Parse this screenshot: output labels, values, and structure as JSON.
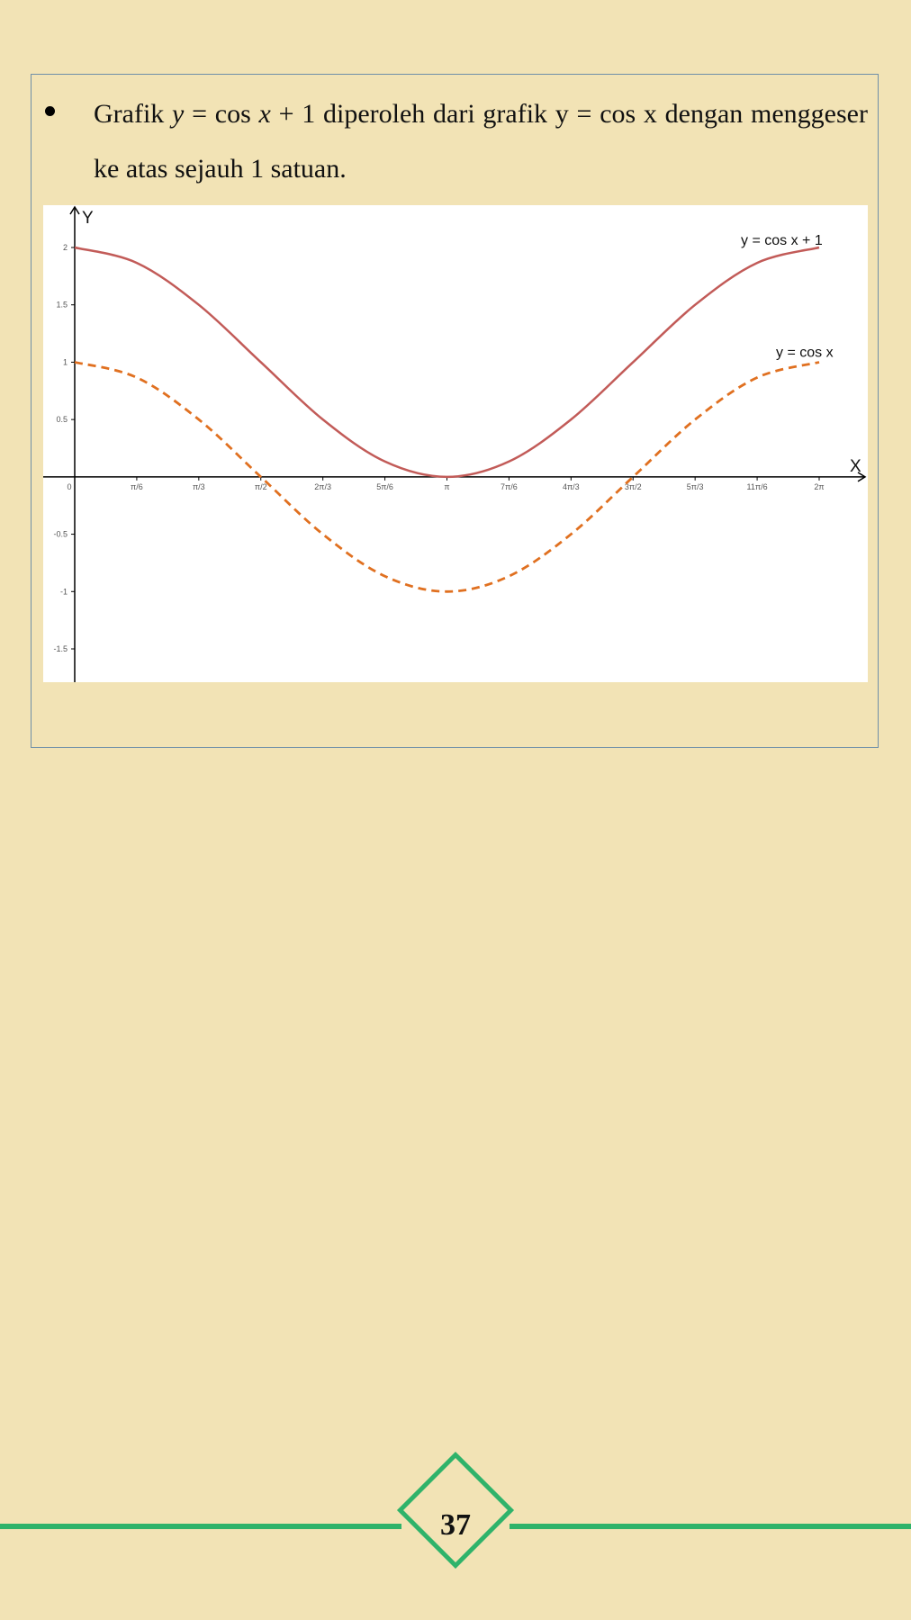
{
  "text": {
    "word_grafik": "Grafik",
    "eq_y": "y",
    "eq_eq": " = cos ",
    "eq_x": "x",
    "eq_rest": " + 1",
    "sentence_rest": " diperoleh dari grafik y = cos x dengan menggeser ke atas sejauh 1 satuan."
  },
  "footer": {
    "page_number": "37"
  },
  "colors": {
    "background": "#f2e3b5",
    "box_border": "#6f8fa8",
    "curve_solid": "#c25b58",
    "curve_dashed": "#e07020",
    "footer_green": "#2fb36a"
  },
  "chart_data": {
    "type": "line",
    "xlabel": "X",
    "ylabel": "Y",
    "x_range": [
      0,
      6.2832
    ],
    "ylim": [
      -1.5,
      2.0
    ],
    "x_ticks": [
      {
        "value": 0,
        "label": "0"
      },
      {
        "value": 0.5236,
        "label": "π/6"
      },
      {
        "value": 1.0472,
        "label": "π/3"
      },
      {
        "value": 1.5708,
        "label": "π/2"
      },
      {
        "value": 2.0944,
        "label": "2π/3"
      },
      {
        "value": 2.618,
        "label": "5π/6"
      },
      {
        "value": 3.1416,
        "label": "π"
      },
      {
        "value": 3.6652,
        "label": "7π/6"
      },
      {
        "value": 4.1888,
        "label": "4π/3"
      },
      {
        "value": 4.7124,
        "label": "3π/2"
      },
      {
        "value": 5.236,
        "label": "5π/3"
      },
      {
        "value": 5.7596,
        "label": "11π/6"
      },
      {
        "value": 6.2832,
        "label": "2π"
      }
    ],
    "y_ticks": [
      {
        "value": 2,
        "label": "2"
      },
      {
        "value": 1.5,
        "label": "1.5"
      },
      {
        "value": 1,
        "label": "1"
      },
      {
        "value": 0.5,
        "label": "0.5"
      },
      {
        "value": -0.5,
        "label": "-0.5"
      },
      {
        "value": -1,
        "label": "-1"
      },
      {
        "value": -1.5,
        "label": "-1.5"
      }
    ],
    "series": [
      {
        "name": "y = cos x + 1",
        "style": "solid",
        "x": [
          0,
          0.5236,
          1.0472,
          1.5708,
          2.0944,
          2.618,
          3.1416,
          3.6652,
          4.1888,
          4.7124,
          5.236,
          5.7596,
          6.2832
        ],
        "y": [
          2,
          1.866,
          1.5,
          1,
          0.5,
          0.134,
          0,
          0.134,
          0.5,
          1,
          1.5,
          1.866,
          2
        ]
      },
      {
        "name": "y = cos x",
        "style": "dashed",
        "x": [
          0,
          0.5236,
          1.0472,
          1.5708,
          2.0944,
          2.618,
          3.1416,
          3.6652,
          4.1888,
          4.7124,
          5.236,
          5.7596,
          6.2832
        ],
        "y": [
          1,
          0.866,
          0.5,
          0,
          -0.5,
          -0.866,
          -1,
          -0.866,
          -0.5,
          0,
          0.5,
          0.866,
          1
        ]
      }
    ]
  }
}
